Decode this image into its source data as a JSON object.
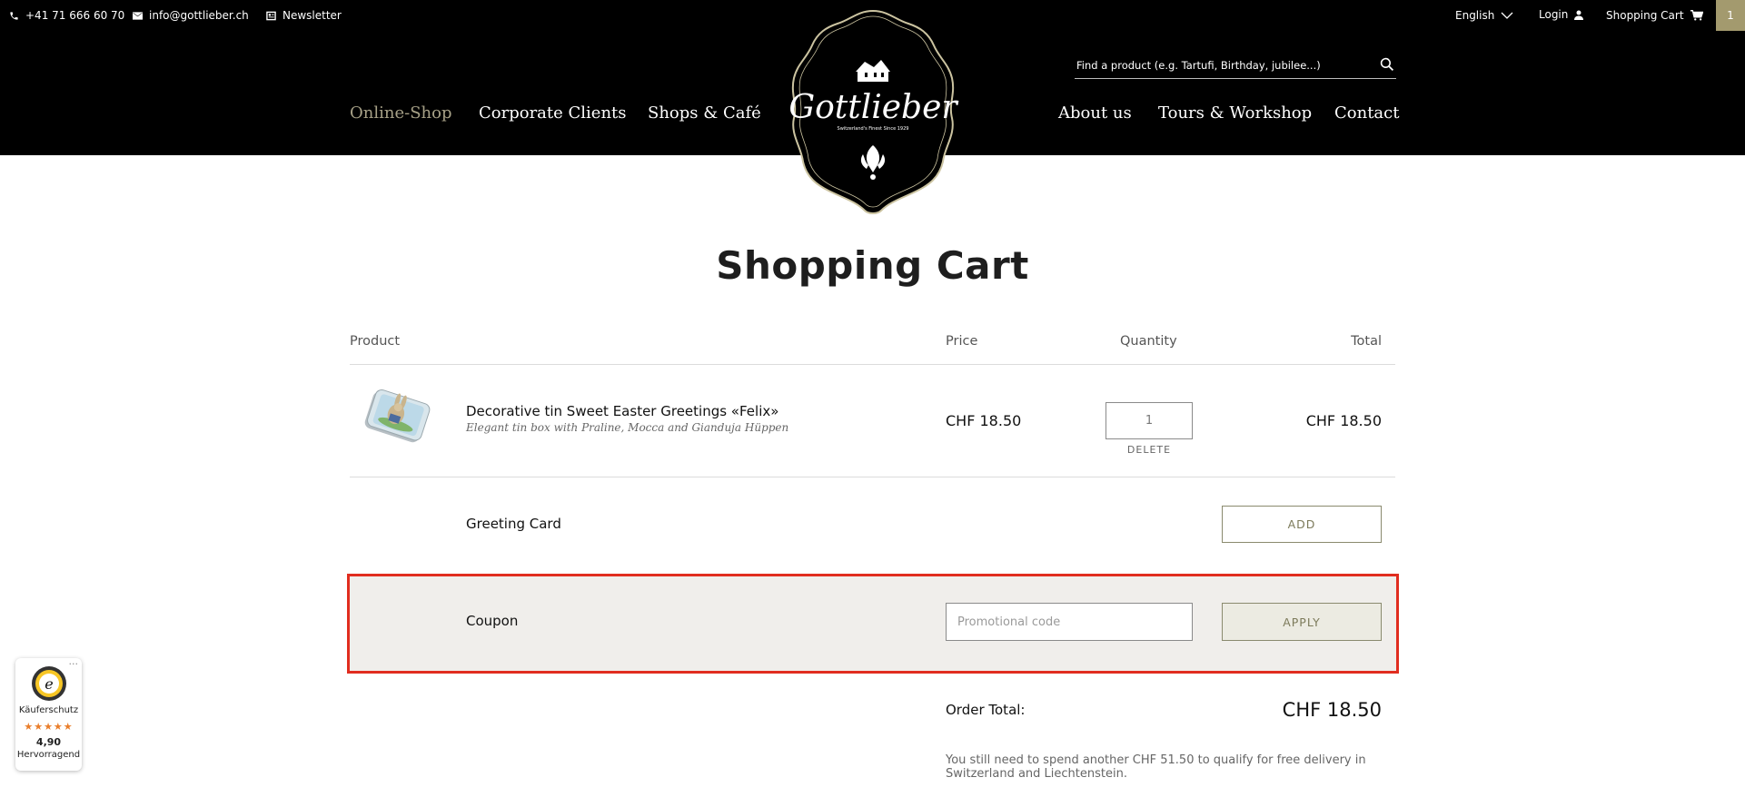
{
  "topbar": {
    "phone": "+41 71 666 60 70",
    "email": "info@gottlieber.ch",
    "newsletter": "Newsletter",
    "language": "English",
    "login": "Login",
    "cart_label": "Shopping Cart",
    "cart_count": "1"
  },
  "search": {
    "placeholder": "Find a product (e.g. Tartufi, Birthday, jubilee...)"
  },
  "nav": {
    "left": [
      "Online-Shop",
      "Corporate Clients",
      "Shops & Café"
    ],
    "right": [
      "About us",
      "Tours & Workshop",
      "Contact"
    ]
  },
  "logo": {
    "brand": "Gottlieber",
    "tagline": "Switzerland's Finest Since 1929"
  },
  "page_title": "Shopping Cart",
  "table": {
    "headers": {
      "product": "Product",
      "price": "Price",
      "quantity": "Quantity",
      "total": "Total"
    },
    "items": [
      {
        "name": "Decorative tin Sweet Easter Greetings «Felix»",
        "subtitle": "Elegant tin box with Praline, Mocca and Gianduja Hüppen",
        "price": "CHF 18.50",
        "quantity": "1",
        "delete": "DELETE",
        "total": "CHF 18.50"
      }
    ]
  },
  "greeting_card": {
    "label": "Greeting Card",
    "button": "ADD"
  },
  "coupon": {
    "label": "Coupon",
    "placeholder": "Promotional code",
    "button": "APPLY"
  },
  "order": {
    "label": "Order Total:",
    "value": "CHF 18.50",
    "note": "You still need to spend another CHF 51.50 to qualify for free delivery in Switzerland and Liechtenstein."
  },
  "trust_badge": {
    "label": "Käuferschutz",
    "rating": "4,90",
    "grade": "Hervorragend",
    "stars": "★★★★★"
  },
  "colors": {
    "accent": "#a39a6e",
    "highlight_border": "#e12d1f",
    "header_bg": "#000000"
  }
}
